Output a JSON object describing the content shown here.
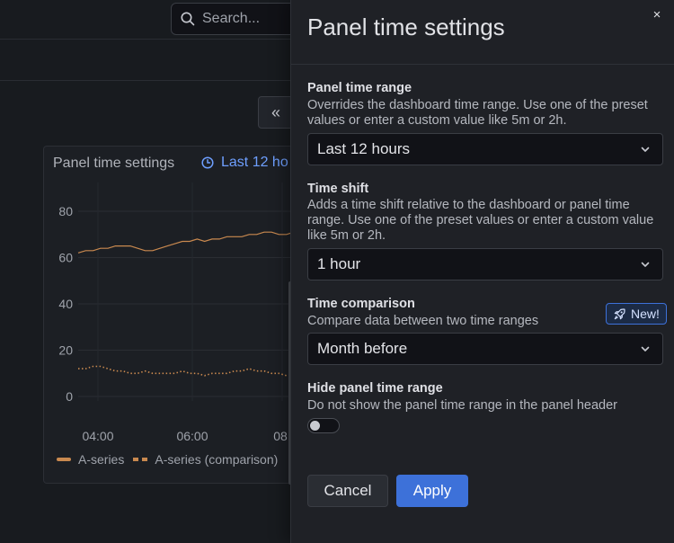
{
  "search": {
    "placeholder": "Search..."
  },
  "toolbar": {
    "collapse_glyph": "«"
  },
  "panel": {
    "title": "Panel time settings",
    "time_range": "Last 12 ho",
    "legend": [
      {
        "label": "A-series",
        "style": "solid"
      },
      {
        "label": "A-series (comparison)",
        "style": "dashed"
      }
    ]
  },
  "chart_data": {
    "type": "line",
    "y_ticks": [
      "80",
      "60",
      "40",
      "20",
      "0"
    ],
    "x_ticks": [
      "04:00",
      "06:00",
      "08:"
    ],
    "ylim": [
      0,
      80
    ],
    "series": [
      {
        "name": "A-series",
        "style": "solid",
        "color": "#c9894f",
        "values": [
          62,
          63,
          63,
          64,
          64,
          65,
          65,
          65,
          64,
          63,
          63,
          64,
          65,
          66,
          67,
          67,
          68,
          67,
          68,
          68,
          69,
          69,
          69,
          70,
          70,
          71,
          71,
          70,
          70,
          71
        ]
      },
      {
        "name": "A-series (comparison)",
        "style": "dotted",
        "color": "#c9894f",
        "values": [
          12,
          12,
          13,
          13,
          12,
          11,
          11,
          10,
          10,
          11,
          10,
          10,
          10,
          10,
          11,
          10,
          10,
          9,
          10,
          10,
          10,
          11,
          11,
          12,
          11,
          11,
          10,
          10,
          9,
          9
        ]
      }
    ]
  },
  "drawer": {
    "title": "Panel time settings",
    "close_glyph": "×",
    "panel_time_range": {
      "label": "Panel time range",
      "description": "Overrides the dashboard time range. Use one of the preset values or enter a custom value like 5m or 2h.",
      "value": "Last 12 hours"
    },
    "time_shift": {
      "label": "Time shift",
      "description": "Adds a time shift relative to the dashboard or panel time range. Use one of the preset values or enter a custom value like 5m or 2h.",
      "value": "1 hour"
    },
    "time_comparison": {
      "label": "Time comparison",
      "description": "Compare data between two time ranges",
      "badge": "New!",
      "value": "Month before"
    },
    "hide_time_range": {
      "label": "Hide panel time range",
      "description": "Do not show the panel time range in the panel header",
      "enabled": false
    },
    "cancel_label": "Cancel",
    "apply_label": "Apply"
  },
  "colors": {
    "accent": "#3d71d9",
    "series": "#c9894f",
    "link": "#6e9fff"
  }
}
